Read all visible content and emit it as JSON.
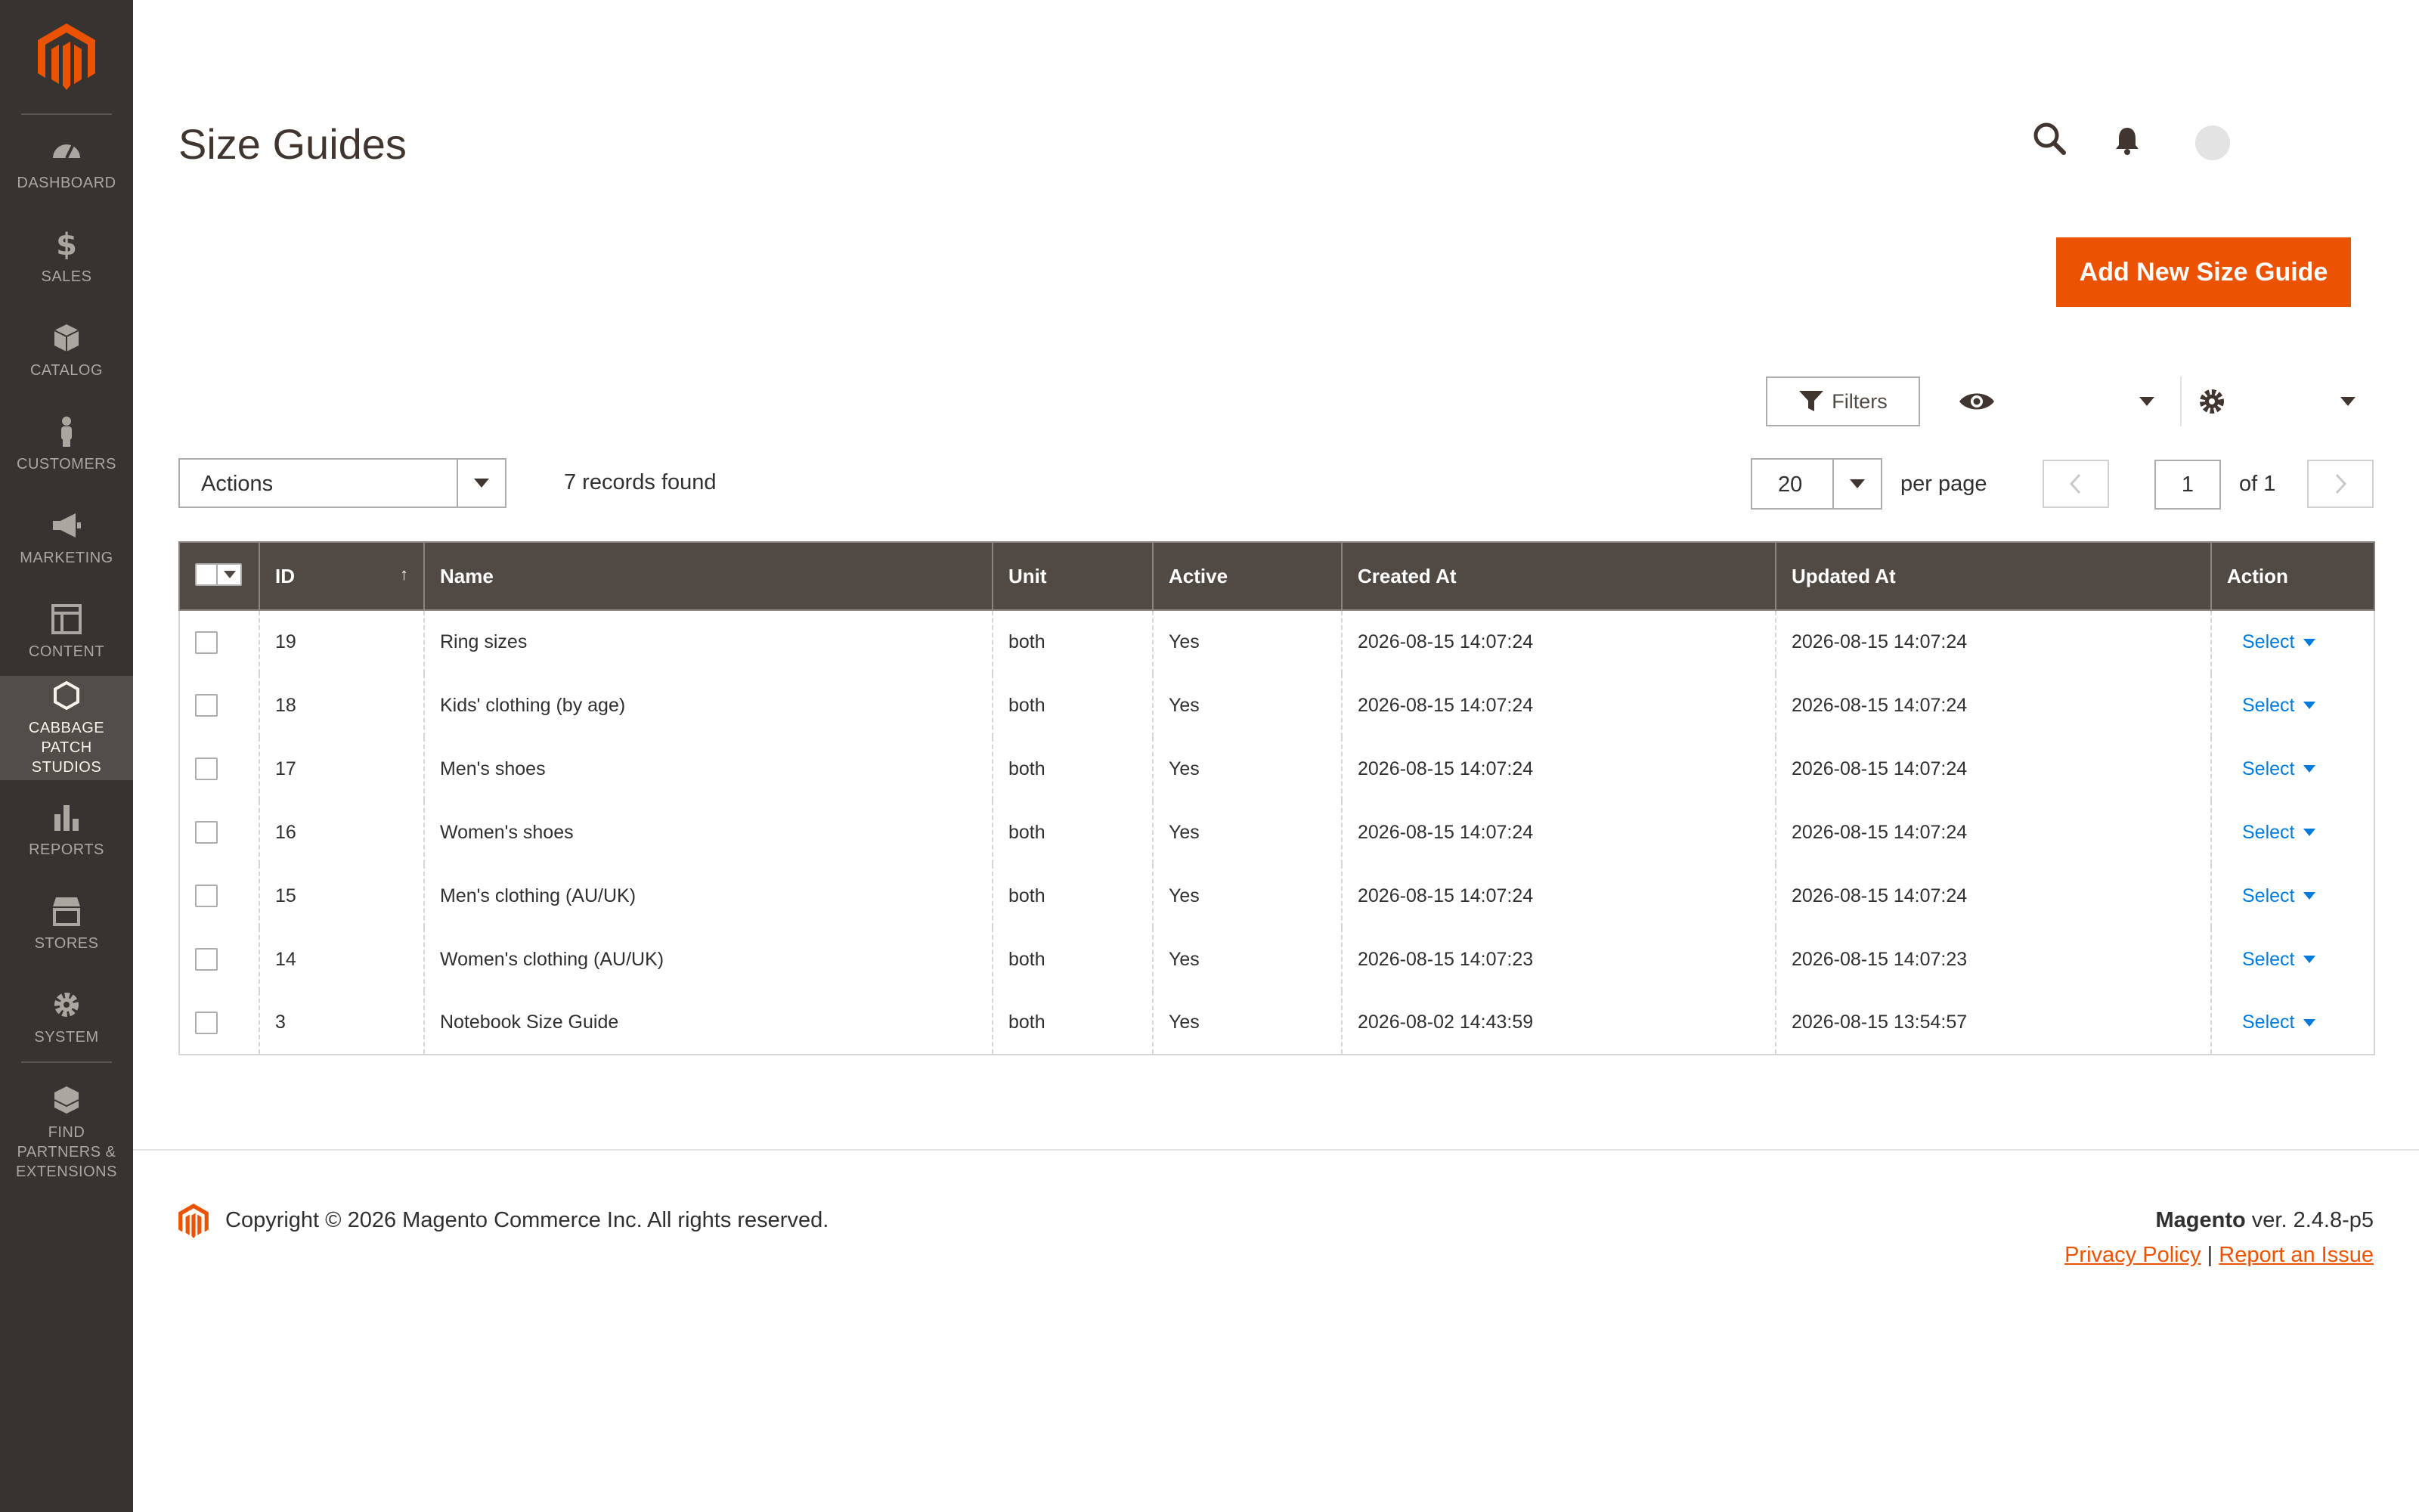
{
  "colors": {
    "sidebar_bg": "#373330",
    "accent": "#eb5202",
    "header_bg": "#514943",
    "link": "#007bdb"
  },
  "sidebar": {
    "items": [
      {
        "label": "DASHBOARD",
        "icon": "dashboard-icon"
      },
      {
        "label": "SALES",
        "icon": "dollar-icon"
      },
      {
        "label": "CATALOG",
        "icon": "cube-icon"
      },
      {
        "label": "CUSTOMERS",
        "icon": "person-icon"
      },
      {
        "label": "MARKETING",
        "icon": "megaphone-icon"
      },
      {
        "label": "CONTENT",
        "icon": "layout-icon"
      },
      {
        "label": "CABBAGE PATCH STUDIOS",
        "icon": "hexagon-icon",
        "active": true
      },
      {
        "label": "REPORTS",
        "icon": "bar-chart-icon"
      },
      {
        "label": "STORES",
        "icon": "store-icon"
      },
      {
        "label": "SYSTEM",
        "icon": "gear-icon"
      },
      {
        "label": "FIND PARTNERS & EXTENSIONS",
        "icon": "blocks-icon"
      }
    ]
  },
  "header": {
    "title": "Size Guides",
    "add_button": "Add New Size Guide"
  },
  "toolbar": {
    "filters_label": "Filters",
    "actions_label": "Actions",
    "records_found": "7 records found",
    "per_page_value": "20",
    "per_page_label": "per page",
    "page_value": "1",
    "page_of": "of 1"
  },
  "grid": {
    "columns": [
      "ID",
      "Name",
      "Unit",
      "Active",
      "Created At",
      "Updated At",
      "Action"
    ],
    "rows": [
      {
        "id": "19",
        "name": "Ring sizes",
        "unit": "both",
        "active": "Yes",
        "created": "2026-08-15 14:07:24",
        "updated": "2026-08-15 14:07:24",
        "action": "Select"
      },
      {
        "id": "18",
        "name": "Kids' clothing (by age)",
        "unit": "both",
        "active": "Yes",
        "created": "2026-08-15 14:07:24",
        "updated": "2026-08-15 14:07:24",
        "action": "Select"
      },
      {
        "id": "17",
        "name": "Men's shoes",
        "unit": "both",
        "active": "Yes",
        "created": "2026-08-15 14:07:24",
        "updated": "2026-08-15 14:07:24",
        "action": "Select"
      },
      {
        "id": "16",
        "name": "Women's shoes",
        "unit": "both",
        "active": "Yes",
        "created": "2026-08-15 14:07:24",
        "updated": "2026-08-15 14:07:24",
        "action": "Select"
      },
      {
        "id": "15",
        "name": "Men's clothing (AU/UK)",
        "unit": "both",
        "active": "Yes",
        "created": "2026-08-15 14:07:24",
        "updated": "2026-08-15 14:07:24",
        "action": "Select"
      },
      {
        "id": "14",
        "name": "Women's clothing (AU/UK)",
        "unit": "both",
        "active": "Yes",
        "created": "2026-08-15 14:07:23",
        "updated": "2026-08-15 14:07:23",
        "action": "Select"
      },
      {
        "id": "3",
        "name": "Notebook Size Guide",
        "unit": "both",
        "active": "Yes",
        "created": "2026-08-02 14:43:59",
        "updated": "2026-08-15 13:54:57",
        "action": "Select"
      }
    ]
  },
  "footer": {
    "copyright": "Copyright © 2026 Magento Commerce Inc. All rights reserved.",
    "brand": "Magento",
    "version": " ver. 2.4.8-p5",
    "privacy": "Privacy Policy",
    "separator": "|",
    "report": "Report an Issue"
  }
}
